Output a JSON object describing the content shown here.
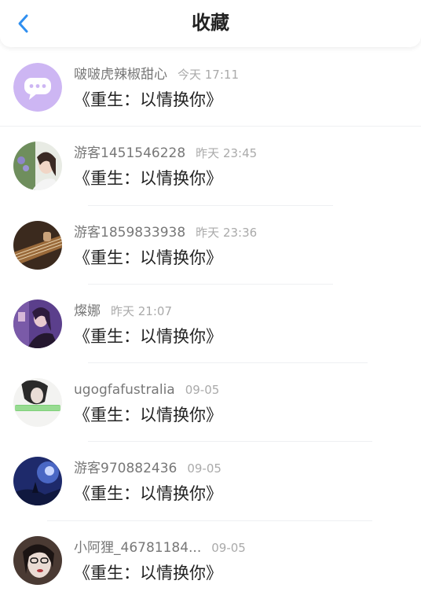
{
  "header": {
    "title": "收藏",
    "back_icon": "chevron-left-icon",
    "accent_color": "#2f8ff0"
  },
  "favorites": [
    {
      "username": "啵啵虎辣椒甜心",
      "time": "今天 17:11",
      "title": "《重生：以情换你》",
      "avatar": "chat-bubble-icon"
    },
    {
      "username": "游客1451546228",
      "time": "昨天 23:45",
      "title": "《重生：以情换你》",
      "avatar": "user-photo"
    },
    {
      "username": "游客1859833938",
      "time": "昨天 23:36",
      "title": "《重生：以情换你》",
      "avatar": "user-photo"
    },
    {
      "username": "燦娜",
      "time": "昨天 21:07",
      "title": "《重生：以情换你》",
      "avatar": "user-photo"
    },
    {
      "username": "ugogfafustralia",
      "time": "09-05",
      "title": "《重生：以情换你》",
      "avatar": "user-photo"
    },
    {
      "username": "游客970882436",
      "time": "09-05",
      "title": "《重生：以情换你》",
      "avatar": "user-photo"
    },
    {
      "username": "小阿狸_46781184...",
      "time": "09-05",
      "title": "《重生：以情换你》",
      "avatar": "user-photo"
    }
  ]
}
